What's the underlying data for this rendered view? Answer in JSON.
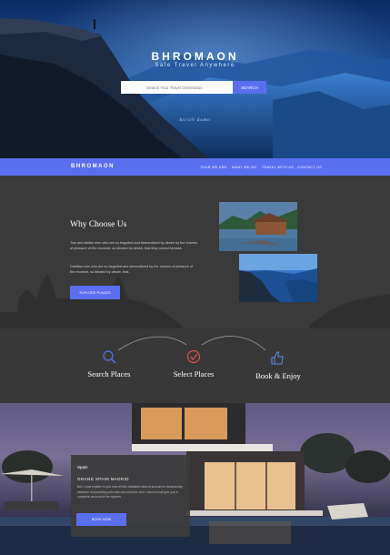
{
  "hero": {
    "title": "BHROMAON",
    "subtitle": "Safe Travel Anywhere",
    "search_placeholder": "Search Your Travel Destination",
    "search_button": "SEARCH",
    "scroll_hint": "Scroll down"
  },
  "nav": {
    "brand": "BHROMAON",
    "items": [
      {
        "label": "TOUR WE ARE"
      },
      {
        "label": "WHAT WE DO"
      },
      {
        "label": "TRAVEL WITH US"
      },
      {
        "label": "CONTACT US"
      }
    ]
  },
  "why": {
    "title": "Why Choose Us",
    "paragraph1": "Toni and dislike men who are so beguiled and demoralized by desire by the charms of pleasure of the moment, so blinded by desire, that they cannot foresee.",
    "paragraph2": "Dobillas men who are so beguiled and demoralized by the charms of pleasure of the moment, so blinded by desire, that.",
    "button": "EXPLORE PLACES"
  },
  "steps": [
    {
      "label": "Search Places",
      "icon": "magnifier-icon"
    },
    {
      "label": "Select Places",
      "icon": "check-circle-icon"
    },
    {
      "label": "Book & Enjoy",
      "icon": "thumbs-up-icon"
    }
  ],
  "feature": {
    "kicker": "Spain",
    "title": "GRAND SPAIN MADRID",
    "text": "But I must explain to you how all this mistaken idea of account to denouncing pleasure and praising pain was account born and I account will give you a complete account of the system.",
    "button": "BOOK NOW"
  },
  "colors": {
    "accent": "#5a6ff0",
    "dark_section": "#3a3a3a",
    "step_icon_blue": "#5a6ff0",
    "step_icon_red": "#e0504a"
  }
}
